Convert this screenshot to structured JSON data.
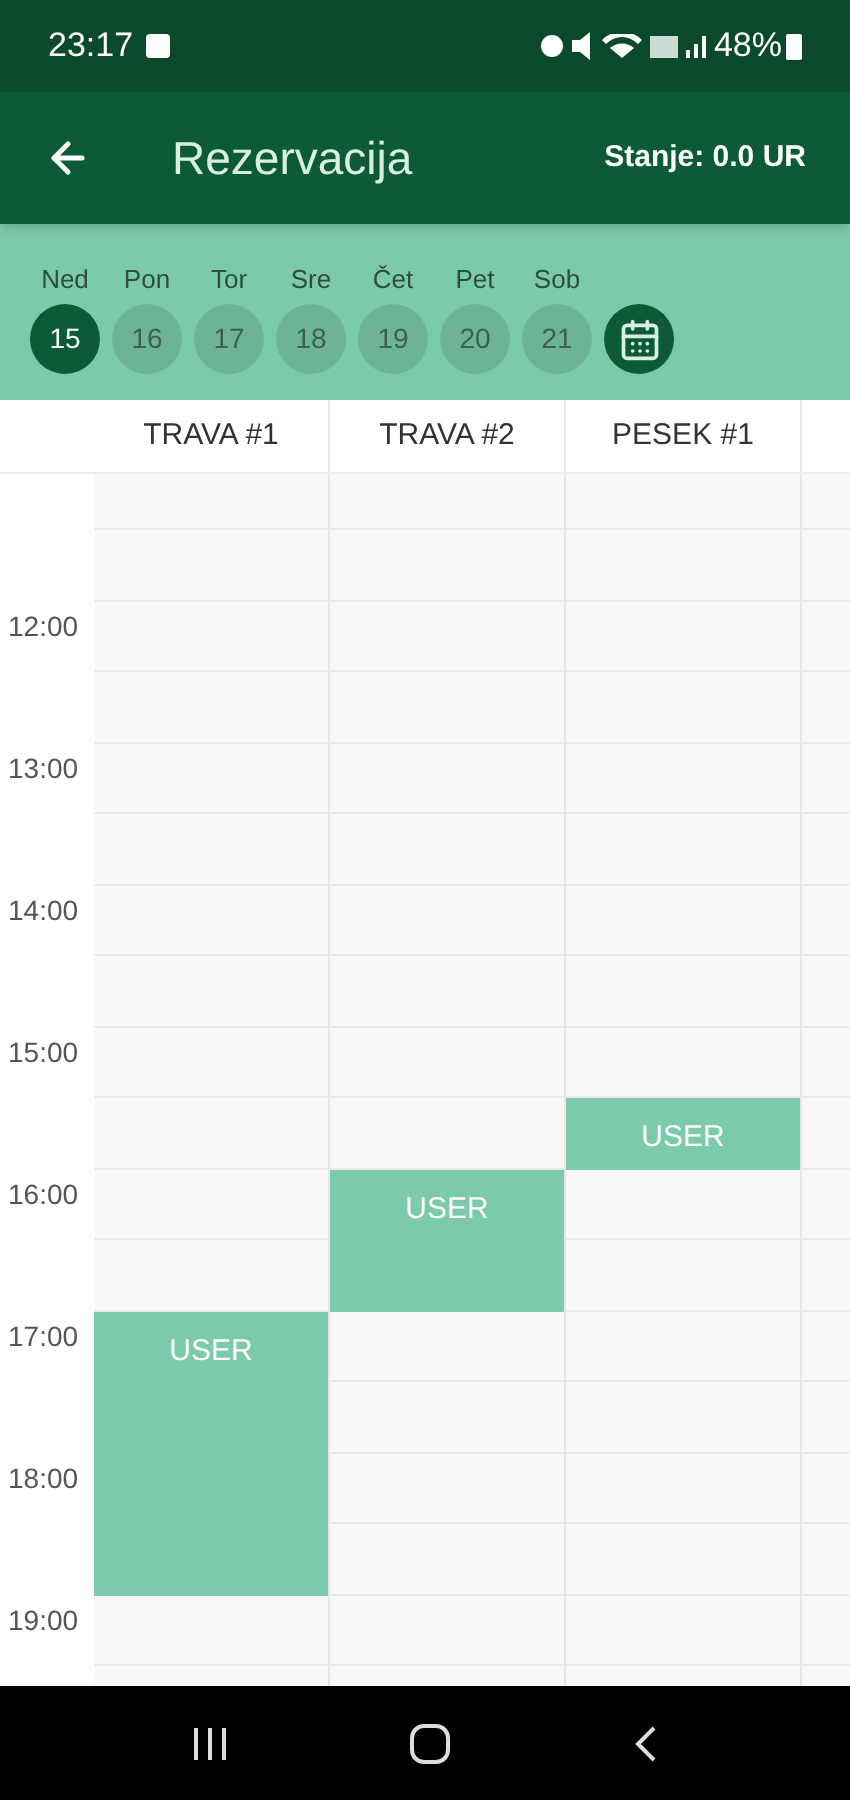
{
  "status_bar": {
    "time": "23:17",
    "battery": "48%"
  },
  "app_bar": {
    "title": "Rezervacija",
    "balance": "Stanje: 0.0 UR"
  },
  "days": [
    {
      "weekday": "Ned",
      "date": "15",
      "selected": true
    },
    {
      "weekday": "Pon",
      "date": "16",
      "selected": false
    },
    {
      "weekday": "Tor",
      "date": "17",
      "selected": false
    },
    {
      "weekday": "Sre",
      "date": "18",
      "selected": false
    },
    {
      "weekday": "Čet",
      "date": "19",
      "selected": false
    },
    {
      "weekday": "Pet",
      "date": "20",
      "selected": false
    },
    {
      "weekday": "Sob",
      "date": "21",
      "selected": false
    }
  ],
  "time_labels": [
    "12:00",
    "13:00",
    "14:00",
    "15:00",
    "16:00",
    "17:00",
    "18:00",
    "19:00"
  ],
  "courts": [
    {
      "name": "TRAVA #1",
      "slots": [
        {
          "booked": false
        },
        {
          "booked": false
        },
        {
          "booked": false
        },
        {
          "booked": false
        },
        {
          "booked": false
        },
        {
          "booked": false
        },
        {
          "booked": false
        },
        {
          "booked": false
        },
        {
          "booked": false
        },
        {
          "booked": false
        },
        {
          "booked": false
        },
        {
          "booked": false
        },
        {
          "booked": true,
          "label": "USER"
        },
        {
          "booked": true
        },
        {
          "booked": true
        },
        {
          "booked": true
        },
        {
          "booked": false
        }
      ]
    },
    {
      "name": "TRAVA #2",
      "slots": [
        {
          "booked": false
        },
        {
          "booked": false
        },
        {
          "booked": false
        },
        {
          "booked": false
        },
        {
          "booked": false
        },
        {
          "booked": false
        },
        {
          "booked": false
        },
        {
          "booked": false
        },
        {
          "booked": false
        },
        {
          "booked": false
        },
        {
          "booked": true,
          "label": "USER"
        },
        {
          "booked": true
        },
        {
          "booked": false
        },
        {
          "booked": false
        },
        {
          "booked": false
        },
        {
          "booked": false
        },
        {
          "booked": false
        }
      ]
    },
    {
      "name": "PESEK #1",
      "slots": [
        {
          "booked": false
        },
        {
          "booked": false
        },
        {
          "booked": false
        },
        {
          "booked": false
        },
        {
          "booked": false
        },
        {
          "booked": false
        },
        {
          "booked": false
        },
        {
          "booked": false
        },
        {
          "booked": false
        },
        {
          "booked": true,
          "label": "USER"
        },
        {
          "booked": false
        },
        {
          "booked": false
        },
        {
          "booked": false
        },
        {
          "booked": false
        },
        {
          "booked": false
        },
        {
          "booked": false
        },
        {
          "booked": false
        }
      ]
    }
  ]
}
